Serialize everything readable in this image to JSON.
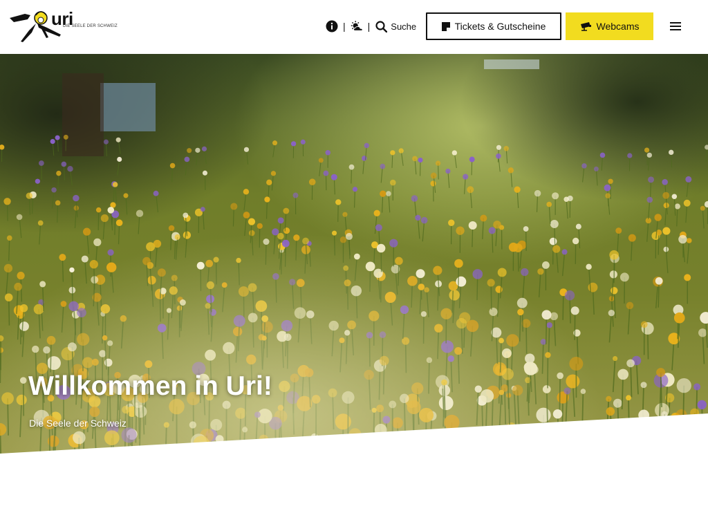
{
  "brand": {
    "name": "uri",
    "tagline": "DIE SEELE DER SCHWEIZ",
    "colors": {
      "accent": "#f2dc1f",
      "text": "#111111",
      "background": "#ffffff"
    }
  },
  "header": {
    "utility_icons": [
      "info-icon",
      "weather-icon"
    ],
    "separator": "|",
    "search_label": "Suche",
    "tickets_label": "Tickets & Gutscheine",
    "tickets_icon": "ticket-icon",
    "webcams_label": "Webcams",
    "webcams_icon": "camera-icon",
    "menu_icon": "hamburger-menu-icon"
  },
  "hero": {
    "title": "Willkommen in Uri!",
    "subtitle": "Die Seele der Schweiz",
    "image_subject": "wildflower meadow"
  }
}
